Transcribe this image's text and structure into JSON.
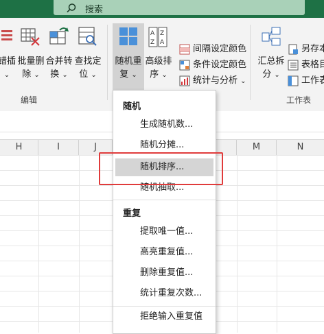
{
  "search": {
    "label": "搜索"
  },
  "ribbon": {
    "buttons": [
      {
        "line1": "错插",
        "line2": ""
      },
      {
        "line1": "批量删",
        "line2": "除"
      },
      {
        "line1": "合并转",
        "line2": "换"
      },
      {
        "line1": "查找定",
        "line2": "位"
      },
      {
        "line1": "随机重",
        "line2": "复"
      },
      {
        "line1": "高级排",
        "line2": "序"
      },
      {
        "line1": "汇总拆",
        "line2": "分"
      }
    ],
    "small_items": [
      "间隔设定颜色",
      "条件设定颜色",
      "统计与分析",
      "另存本",
      "表格目",
      "工作表"
    ],
    "groups": {
      "edit": "编辑",
      "worksheet": "工作表"
    },
    "accent": "#1e7145"
  },
  "sheet": {
    "columns": [
      "H",
      "I",
      "J",
      "M",
      "N"
    ]
  },
  "menu": {
    "section1": "随机",
    "items1": [
      "生成随机数...",
      "随机分摊...",
      "随机排序...",
      "随机抽取..."
    ],
    "section2": "重复",
    "items2": [
      "提取唯一值...",
      "高亮重复值...",
      "删除重复值...",
      "统计重复次数...",
      "拒绝输入重复值"
    ],
    "highlighted": "随机排序..."
  }
}
